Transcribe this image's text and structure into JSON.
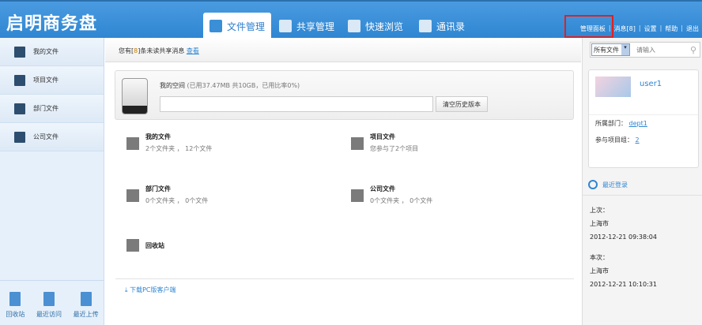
{
  "header": {
    "logo": "启明商务盘",
    "tabs": [
      "文件管理",
      "共享管理",
      "快速浏览",
      "通讯录"
    ],
    "links": [
      "管理面板",
      "消息[8]",
      "设置",
      "帮助",
      "退出"
    ]
  },
  "sidebar": {
    "items": [
      "我的文件",
      "项目文件",
      "部门文件",
      "公司文件"
    ],
    "bottom": [
      "回收站",
      "最近访问",
      "最近上传"
    ]
  },
  "notice": {
    "prefix": "您有[",
    "count": "8",
    "suffix": "]条未读共享消息",
    "link": "查看"
  },
  "storage": {
    "title": "我的空间",
    "detail": "(已用37.47MB 共10GB，已用比率0%)",
    "usage_percent": 0,
    "clear_button": "清空历史版本"
  },
  "files": [
    {
      "title": "我的文件",
      "desc": "2个文件夹 ， 12个文件"
    },
    {
      "title": "项目文件",
      "desc": "您参与了2个项目"
    },
    {
      "title": "部门文件",
      "desc": "0个文件夹 ， 0个文件"
    },
    {
      "title": "公司文件",
      "desc": "0个文件夹 ， 0个文件"
    },
    {
      "title": "回收站",
      "desc": ""
    }
  ],
  "download": "下载PC版客户端",
  "search": {
    "scope": "所有文件",
    "placeholder": "请输入"
  },
  "user": {
    "name": "user1",
    "dept_label": "所属部门：",
    "dept": "dept1",
    "proj_label": "参与项目组：",
    "proj": "2"
  },
  "recent": {
    "title": "最近登录",
    "last_label": "上次：",
    "last_city": "上海市",
    "last_time": "2012-12-21 09:38:04",
    "this_label": "本次：",
    "this_city": "上海市",
    "this_time": "2012-12-21 10:10:31"
  }
}
